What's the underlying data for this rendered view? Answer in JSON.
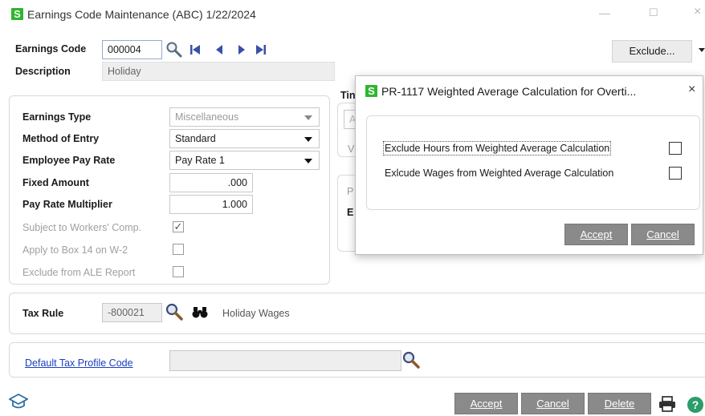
{
  "window": {
    "title": "Earnings Code Maintenance (ABC) 1/22/2024",
    "logo": "S",
    "minimize_glyph": "—",
    "maximize_glyph": "☐",
    "close_glyph": "×"
  },
  "header": {
    "earnings_code_label": "Earnings Code",
    "earnings_code_value": "000004",
    "description_label": "Description",
    "description_value": "Holiday",
    "exclude_button": "Exclude..."
  },
  "main": {
    "earnings_type_label": "Earnings Type",
    "earnings_type_value": "Miscellaneous",
    "method_of_entry_label": "Method of Entry",
    "method_of_entry_value": "Standard",
    "employee_pay_rate_label": "Employee Pay Rate",
    "employee_pay_rate_value": "Pay Rate 1",
    "fixed_amount_label": "Fixed Amount",
    "fixed_amount_value": ".000",
    "pay_rate_multiplier_label": "Pay Rate Multiplier",
    "pay_rate_multiplier_value": "1.000",
    "subject_workers_comp_label": "Subject to Workers' Comp.",
    "subject_workers_comp_checked": true,
    "apply_box14_label": "Apply to Box 14 on W-2",
    "apply_box14_checked": false,
    "exclude_ale_label": "Exclude from ALE Report",
    "exclude_ale_checked": false,
    "partial_right_label_1": "Tin",
    "partial_right_label_2": "A",
    "partial_right_label_3": "V",
    "partial_right_label_4": "P",
    "partial_right_label_5": "E"
  },
  "tax": {
    "tax_rule_label": "Tax Rule",
    "tax_rule_value": "-800021",
    "tax_rule_description": "Holiday Wages",
    "default_tax_profile_label": "Default Tax Profile Code",
    "default_tax_profile_value": ""
  },
  "footer": {
    "accept": "Accept",
    "cancel": "Cancel",
    "delete": "Delete"
  },
  "modal": {
    "logo": "S",
    "title": "PR-1117 Weighted Average Calculation for Overti...",
    "close_glyph": "×",
    "exclude_hours_label": "Exclude Hours from Weighted Average Calculation",
    "exclude_hours_checked": false,
    "exclude_wages_label": "Exlcude Wages from Weighted Average Calculation",
    "exclude_wages_checked": false,
    "accept": "Accept",
    "cancel": "Cancel"
  },
  "colors": {
    "logo_green": "#2fb52f",
    "button_gray": "#8a8a8a",
    "link_blue": "#1a3fbf",
    "help_green": "#2a9d6a"
  }
}
